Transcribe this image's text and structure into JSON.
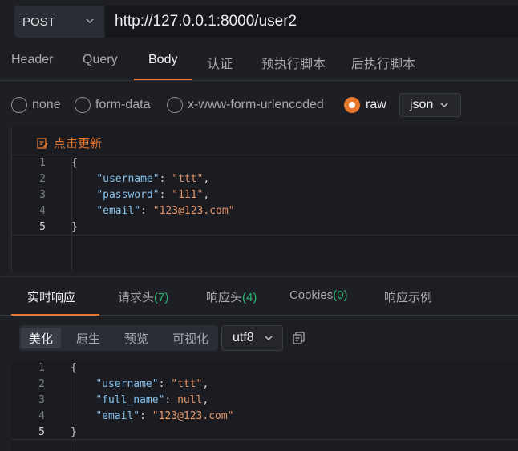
{
  "request": {
    "method": "POST",
    "url": "http://127.0.0.1:8000/user2"
  },
  "tabs": [
    "Header",
    "Query",
    "Body",
    "认证",
    "预执行脚本",
    "后执行脚本"
  ],
  "body_types": [
    {
      "label": "none",
      "selected": false
    },
    {
      "label": "form-data",
      "selected": false
    },
    {
      "label": "x-www-form-urlencoded",
      "selected": false
    },
    {
      "label": "raw",
      "selected": true
    }
  ],
  "raw_format": "json",
  "editor": {
    "update_label": "点击更新",
    "line_numbers": [
      "1",
      "2",
      "3",
      "4",
      "5"
    ],
    "lines": {
      "l1": "{",
      "l2_key": "\"username\"",
      "l2_val": "\"ttt\"",
      "l3_key": "\"password\"",
      "l3_val": "\"111\"",
      "l4_key": "\"email\"",
      "l4_val": "\"123@123.com\"",
      "l5": "}"
    }
  },
  "response_tabs": {
    "realtime": "实时响应",
    "req_headers": "请求头",
    "req_headers_count": "(7)",
    "resp_headers": "响应头",
    "resp_headers_count": "(4)",
    "cookies": "Cookies",
    "cookies_count": "(0)",
    "example": "响应示例"
  },
  "view_modes": [
    "美化",
    "原生",
    "预览",
    "可视化"
  ],
  "encoding": "utf8",
  "response": {
    "line_numbers": [
      "1",
      "2",
      "3",
      "4",
      "5"
    ],
    "lines": {
      "l1": "{",
      "l2_key": "\"username\"",
      "l2_val": "\"ttt\"",
      "l3_key": "\"full_name\"",
      "l3_val": "null",
      "l4_key": "\"email\"",
      "l4_val": "\"123@123.com\"",
      "l5": "}"
    }
  },
  "colors": {
    "accent": "#e8762b",
    "count_green": "#27b573",
    "json_key": "#86c3f0",
    "json_string": "#e69566"
  }
}
